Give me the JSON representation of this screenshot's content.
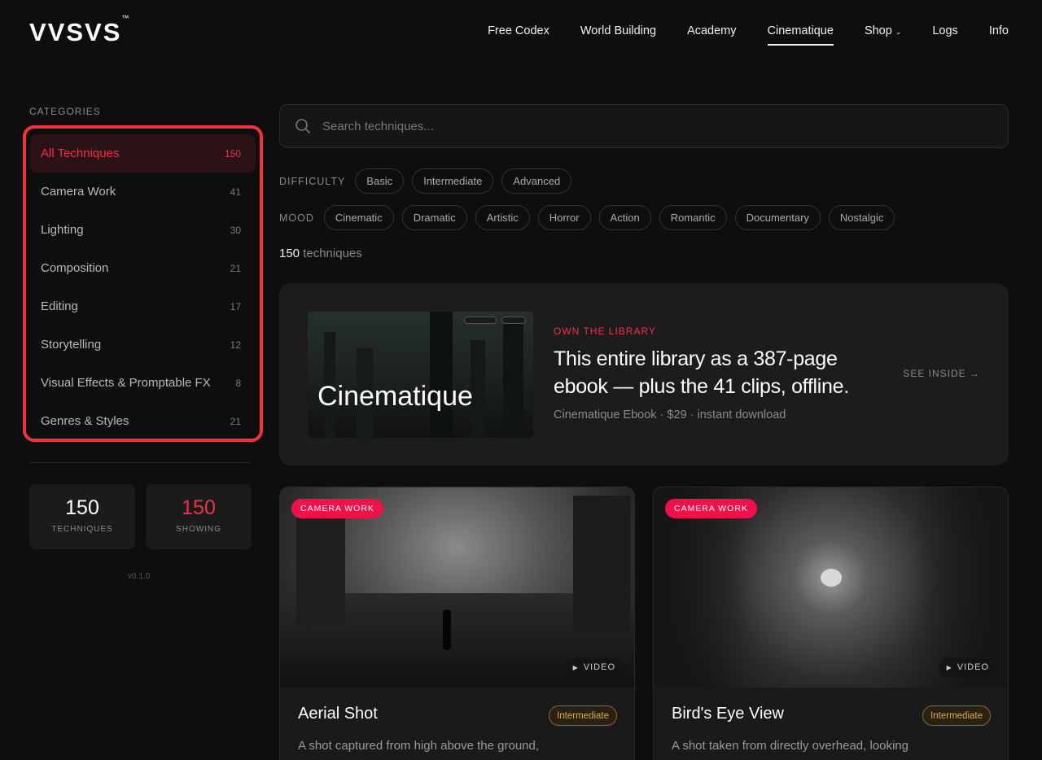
{
  "header": {
    "logo": "VVSVS",
    "logo_tm": "™",
    "nav": [
      {
        "label": "Free Codex"
      },
      {
        "label": "World Building"
      },
      {
        "label": "Academy"
      },
      {
        "label": "Cinematique",
        "active": true
      },
      {
        "label": "Shop",
        "dropdown": true
      },
      {
        "label": "Logs"
      },
      {
        "label": "Info"
      }
    ],
    "shop_chevron": "⌄"
  },
  "sidebar": {
    "title": "CATEGORIES",
    "items": [
      {
        "label": "All Techniques",
        "count": "150",
        "active": true
      },
      {
        "label": "Camera Work",
        "count": "41"
      },
      {
        "label": "Lighting",
        "count": "30"
      },
      {
        "label": "Composition",
        "count": "21"
      },
      {
        "label": "Editing",
        "count": "17"
      },
      {
        "label": "Storytelling",
        "count": "12"
      },
      {
        "label": "Visual Effects & Promptable FX",
        "count": "8"
      },
      {
        "label": "Genres & Styles",
        "count": "21"
      }
    ],
    "stats": [
      {
        "value": "150",
        "label": "TECHNIQUES"
      },
      {
        "value": "150",
        "label": "SHOWING"
      }
    ],
    "version": "v0.1.0"
  },
  "search": {
    "placeholder": "Search techniques..."
  },
  "filters": {
    "difficulty_label": "DIFFICULTY",
    "difficulty": [
      "Basic",
      "Intermediate",
      "Advanced"
    ],
    "mood_label": "MOOD",
    "mood": [
      "Cinematic",
      "Dramatic",
      "Artistic",
      "Horror",
      "Action",
      "Romantic",
      "Documentary",
      "Nostalgic"
    ]
  },
  "results": {
    "count": "150",
    "suffix": " techniques"
  },
  "promo": {
    "image_title": "Cinematique",
    "eyebrow": "OWN THE LIBRARY",
    "headline": "This entire library as a 387-page ebook — plus the 41 clips, offline.",
    "meta": "Cinematique Ebook · $29 · instant download",
    "cta": "SEE INSIDE →"
  },
  "cards": [
    {
      "category": "CAMERA WORK",
      "title": "Aerial Shot",
      "level": "Intermediate",
      "media": "VIDEO",
      "description": "A shot captured from high above the ground,"
    },
    {
      "category": "CAMERA WORK",
      "title": "Bird's Eye View",
      "level": "Intermediate",
      "media": "VIDEO",
      "description": "A shot taken from directly overhead, looking"
    }
  ],
  "colors": {
    "accent": "#f0304a",
    "background": "#0e0e0f",
    "highlight_box": "#f2333d",
    "level": "#e0a84a"
  }
}
